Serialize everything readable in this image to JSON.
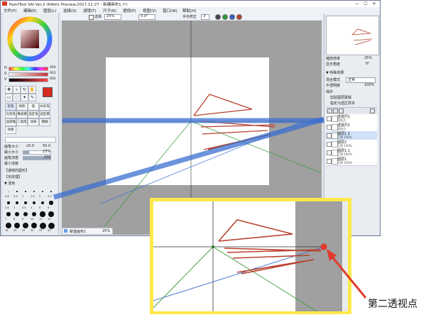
{
  "window": {
    "title": "PaintTool SAI Ver.2 (64bit) Preview.2017.12.27 - 新建画布1 (*)",
    "minimize": "—",
    "maximize": "☐",
    "close": "✕"
  },
  "menu": [
    "文件(F)",
    "编辑(E)",
    "图层(L)",
    "选择(S)",
    "滤镜(T)",
    "尺子(R)",
    "透视(P)",
    "视图(V)",
    "窗口(W)",
    "帮助(H)"
  ],
  "tool_options": {
    "mode_label": "选择",
    "zoom": "25%",
    "angle": "0.0°",
    "stabilizer_label": "手抖修正",
    "stabilizer_value": "3"
  },
  "left_panel": {
    "color_h": "H",
    "color_s": "S",
    "color_v": "V",
    "color_values": [
      "000",
      "001",
      "002"
    ],
    "brush_tabs": [
      "铅笔",
      "喷枪",
      "笔",
      "水彩笔",
      "马克笔",
      "橡皮擦",
      "选区笔",
      "选区擦",
      "油漆桶",
      "二值笔",
      "涂抹",
      "模糊",
      "效果"
    ],
    "brush_size_label": "画笔大小",
    "brush_size_mult": "x5.0",
    "brush_size_value": "50.0",
    "min_size_label": "最小大小",
    "min_size_value": "23%",
    "density_label": "画笔浓度",
    "density_value": "100",
    "min_density_label": "最小浓度",
    "texture_label": "【通常的圆形】",
    "texture2_label": "【无纹理】",
    "blend_label": "▼ 混色",
    "sizes": [
      "0.8",
      "0.9",
      "1",
      "1.5",
      "2",
      "2.3",
      "2.6",
      "3",
      "3.5",
      "4",
      "5",
      "6",
      "7",
      "8",
      "9",
      "10",
      "12",
      "14",
      "16",
      "20",
      "25",
      "30",
      "35",
      "40"
    ]
  },
  "right_panel": {
    "zoom_label": "缩放倍率",
    "zoom_value": "25%",
    "rotate_label": "显示角度",
    "rotate_value": "0°",
    "props_title": "▼ 特殊效果",
    "blend_mode_label": "混合模式",
    "blend_mode_value": "正常",
    "opacity_label": "不透明度",
    "opacity_value": "100%",
    "protect_label": "保护",
    "clip_label": "剪贴图层蒙版",
    "ref_label": "指定为选区样本",
    "layers": [
      {
        "name": "透视尺1",
        "sub": "消失点"
      },
      {
        "name": "透视尺1",
        "sub": "消失点"
      },
      {
        "name": "图层1.2",
        "sub": "正常 100%"
      },
      {
        "name": "图层2",
        "sub": "正常 100%"
      },
      {
        "name": "图层1.1",
        "sub": "正常 100%"
      },
      {
        "name": "图层1",
        "sub": "正常 100%"
      }
    ]
  },
  "status_bar": {
    "doc_name": "新建画布1",
    "zoom": "25%"
  },
  "annotation": {
    "callout": "第二透视点"
  },
  "colors": {
    "accent_blue": "#3b6fd0",
    "sketch_red": "#b8412f",
    "vp_red": "#e23a2c",
    "zoom_border": "#fde84a",
    "guide_green": "#3a9a3a"
  }
}
